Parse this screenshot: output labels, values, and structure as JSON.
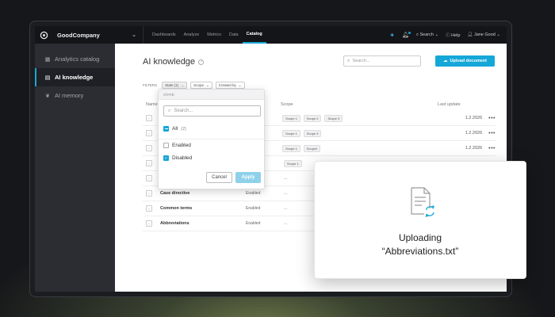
{
  "topbar": {
    "company": "GoodCompany",
    "nav": [
      "Dashboards",
      "Analyze",
      "Metrics",
      "Data",
      "Catalog"
    ],
    "active_nav": "Catalog",
    "search_label": "Search",
    "help_label": "Help",
    "user_label": "Jane Good"
  },
  "sidebar": {
    "items": [
      {
        "label": "Analytics catalog",
        "icon": "grid-icon"
      },
      {
        "label": "AI knowledge",
        "icon": "book-icon"
      },
      {
        "label": "AI memory",
        "icon": "brain-icon"
      }
    ],
    "active": "AI knowledge"
  },
  "main": {
    "title": "AI knowledge",
    "search_placeholder": "Search...",
    "upload_button": "Upload document",
    "filters_label": "FILTERS",
    "filters": [
      "State (1)",
      "Scope",
      "Created by"
    ],
    "columns": {
      "name": "Name",
      "scope": "Scope",
      "last_update": "Last update"
    },
    "rows": [
      {
        "name": "",
        "state": "",
        "scopes": [
          "Scope 1",
          "Scope 2",
          "Scope 3"
        ],
        "date": "1.2.2026"
      },
      {
        "name": "",
        "state": "",
        "scopes": [
          "Scope 1",
          "Scope 3"
        ],
        "date": "1.2.2026"
      },
      {
        "name": "",
        "state": "",
        "scopes": [
          "Scope 1",
          "Scope2"
        ],
        "date": "1.2.2026"
      },
      {
        "name": "",
        "state": "",
        "scopes": [
          "Scope 1"
        ],
        "date": ""
      },
      {
        "name": "",
        "state": "",
        "scopes": [],
        "date": ""
      },
      {
        "name": "Case directive",
        "state": "Enabled",
        "scopes": [],
        "date": ""
      },
      {
        "name": "Common terms",
        "state": "Enabled",
        "scopes": [],
        "date": ""
      },
      {
        "name": "Abbreviations",
        "state": "Enabled",
        "scopes": [],
        "date": ""
      }
    ],
    "empty_scope": "—"
  },
  "state_dropdown": {
    "header": "STATE",
    "search_placeholder": "Search...",
    "all_label": "All",
    "all_count": "(2)",
    "options": [
      {
        "label": "Enabled",
        "checked": false
      },
      {
        "label": "Disabled",
        "checked": true
      }
    ],
    "cancel": "Cancel",
    "apply": "Apply"
  },
  "upload_card": {
    "line1": "Uploading",
    "line2": "“Abbreviations.txt”",
    "icon": "document-sync-icon"
  },
  "colors": {
    "accent": "#15a7d8",
    "topbar": "#141518",
    "sidebar": "#2c2d32"
  }
}
